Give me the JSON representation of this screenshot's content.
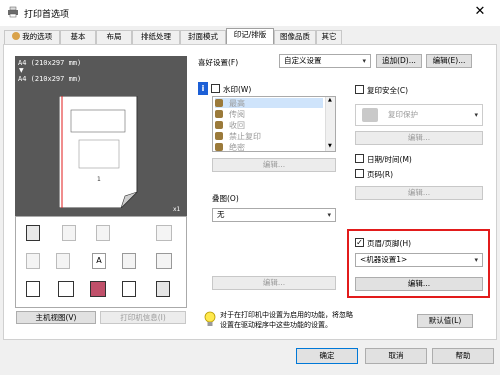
{
  "window": {
    "title": "打印首选项",
    "close_symbol": "✕"
  },
  "tabs": [
    {
      "label": "我的选项"
    },
    {
      "label": "基本"
    },
    {
      "label": "布局"
    },
    {
      "label": "排纸处理"
    },
    {
      "label": "封面模式"
    },
    {
      "label": "印记/排版"
    },
    {
      "label": "图像品质"
    },
    {
      "label": "其它"
    }
  ],
  "active_tab": "印记/排版",
  "preview": {
    "paper_line1": "A4 (210x297 mm)",
    "arrow": "▼",
    "paper_line2": "A4 (210x297 mm)",
    "copies": "x1"
  },
  "view_buttons": {
    "main_view": "主机视图(V)",
    "printer_info": "打印机信息(I)"
  },
  "favorites": {
    "label": "喜好设置(F)",
    "value": "自定义设置",
    "add": "追加(D)...",
    "edit": "编辑(E)..."
  },
  "watermark": {
    "label": "水印(W)",
    "items": [
      "最高",
      "传阅",
      "收回",
      "禁止复印",
      "绝密"
    ],
    "edit": "编辑..."
  },
  "overlay": {
    "label": "叠图(O)",
    "value": "无",
    "edit": "编辑..."
  },
  "copy_security": {
    "label": "复印安全(C)",
    "value": "复印保护",
    "edit": "编辑..."
  },
  "datetime": {
    "label": "日期/时间(M)"
  },
  "page_number": {
    "label": "页码(R)",
    "edit": "编辑..."
  },
  "header_footer": {
    "label": "页眉/页脚(H)",
    "value": "<机器设置1>",
    "edit": "编辑..."
  },
  "info": {
    "text_line1": "对于在打印机中设置为启用的功能，将忽略",
    "text_line2": "设置在驱动程序中这些功能的设置。",
    "default": "默认值(L)"
  },
  "footer": {
    "ok": "确定",
    "cancel": "取消",
    "help": "帮助"
  },
  "colors": {
    "highlight": "#e21b1b",
    "selection": "#3399ff",
    "accent": "#0078d7"
  }
}
